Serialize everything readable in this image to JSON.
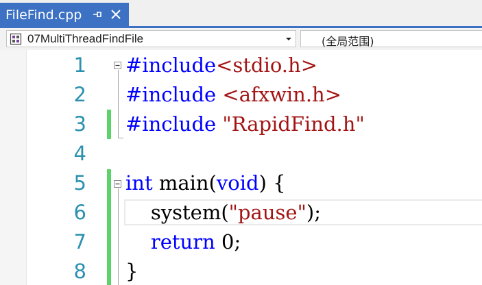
{
  "tab": {
    "title": "FileFind.cpp",
    "pin_icon": "pin-icon",
    "close_icon": "close-icon"
  },
  "navbar": {
    "scope": "07MultiThreadFindFile",
    "member": "(全局范围)"
  },
  "editor": {
    "line_numbers": [
      "1",
      "2",
      "3",
      "4",
      "5",
      "6",
      "7",
      "8"
    ],
    "lines": [
      {
        "parts": [
          {
            "t": "#include",
            "c": "kw"
          },
          {
            "t": "<stdio.h>",
            "c": "str"
          }
        ]
      },
      {
        "parts": [
          {
            "t": "#include",
            "c": "kw"
          },
          {
            "t": " ",
            "c": ""
          },
          {
            "t": "<afxwin.h>",
            "c": "str"
          }
        ]
      },
      {
        "parts": [
          {
            "t": "#include",
            "c": "kw"
          },
          {
            "t": " ",
            "c": ""
          },
          {
            "t": "\"RapidFind.h\"",
            "c": "str"
          }
        ]
      },
      {
        "parts": []
      },
      {
        "parts": [
          {
            "t": "int",
            "c": "kw"
          },
          {
            "t": " main(",
            "c": ""
          },
          {
            "t": "void",
            "c": "kw"
          },
          {
            "t": ") {",
            "c": ""
          }
        ]
      },
      {
        "parts": [
          {
            "t": "    system(",
            "c": ""
          },
          {
            "t": "\"pause\"",
            "c": "str"
          },
          {
            "t": ");",
            "c": ""
          }
        ]
      },
      {
        "parts": [
          {
            "t": "    ",
            "c": ""
          },
          {
            "t": "return",
            "c": "kw"
          },
          {
            "t": " 0;",
            "c": ""
          }
        ]
      },
      {
        "parts": [
          {
            "t": "}",
            "c": ""
          }
        ]
      }
    ]
  },
  "colors": {
    "tab": "#3c71c3",
    "linenumber": "#2b91af",
    "keyword": "#0000ff",
    "string": "#a31515",
    "change": "#5cd36a"
  }
}
